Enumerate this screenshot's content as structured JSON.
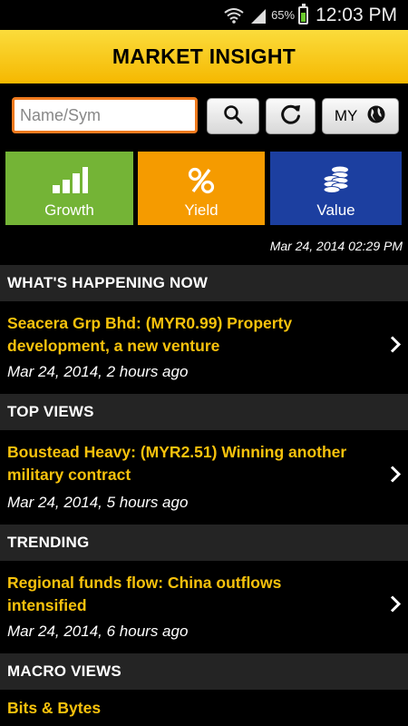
{
  "status_bar": {
    "battery_percent": "65%",
    "time": "12:03 PM",
    "icons": [
      "wifi-icon",
      "signal-icon",
      "battery-icon"
    ]
  },
  "header": {
    "title": "MARKET INSIGHT"
  },
  "search": {
    "placeholder": "Name/Sym",
    "value": ""
  },
  "region": {
    "label": "MY",
    "icon": "globe-icon"
  },
  "tiles": [
    {
      "label": "Growth",
      "icon": "bar-chart-icon",
      "color": "#74b436"
    },
    {
      "label": "Yield",
      "icon": "percent-icon",
      "color": "#f59b00"
    },
    {
      "label": "Value",
      "icon": "coins-icon",
      "color": "#1c3fa0"
    }
  ],
  "timestamp": "Mar 24, 2014 02:29 PM",
  "sections": [
    {
      "header": "WHAT'S HAPPENING NOW",
      "item": {
        "title": "Seacera Grp Bhd: (MYR0.99) Property development, a new venture",
        "date": "Mar 24, 2014, 2 hours ago"
      }
    },
    {
      "header": "TOP VIEWS",
      "item": {
        "title": "Boustead Heavy: (MYR2.51) Winning another military contract",
        "date": "Mar 24, 2014, 5 hours ago"
      }
    },
    {
      "header": "TRENDING",
      "item": {
        "title": "Regional funds flow: China outflows intensified",
        "date": "Mar 24, 2014, 6 hours ago"
      }
    },
    {
      "header": "MACRO VIEWS",
      "item": {
        "title": "Bits & Bytes",
        "date": ""
      }
    }
  ],
  "colors": {
    "accent": "#f7c20c",
    "header_bg": "#f5b800",
    "search_border": "#f07a1e"
  }
}
